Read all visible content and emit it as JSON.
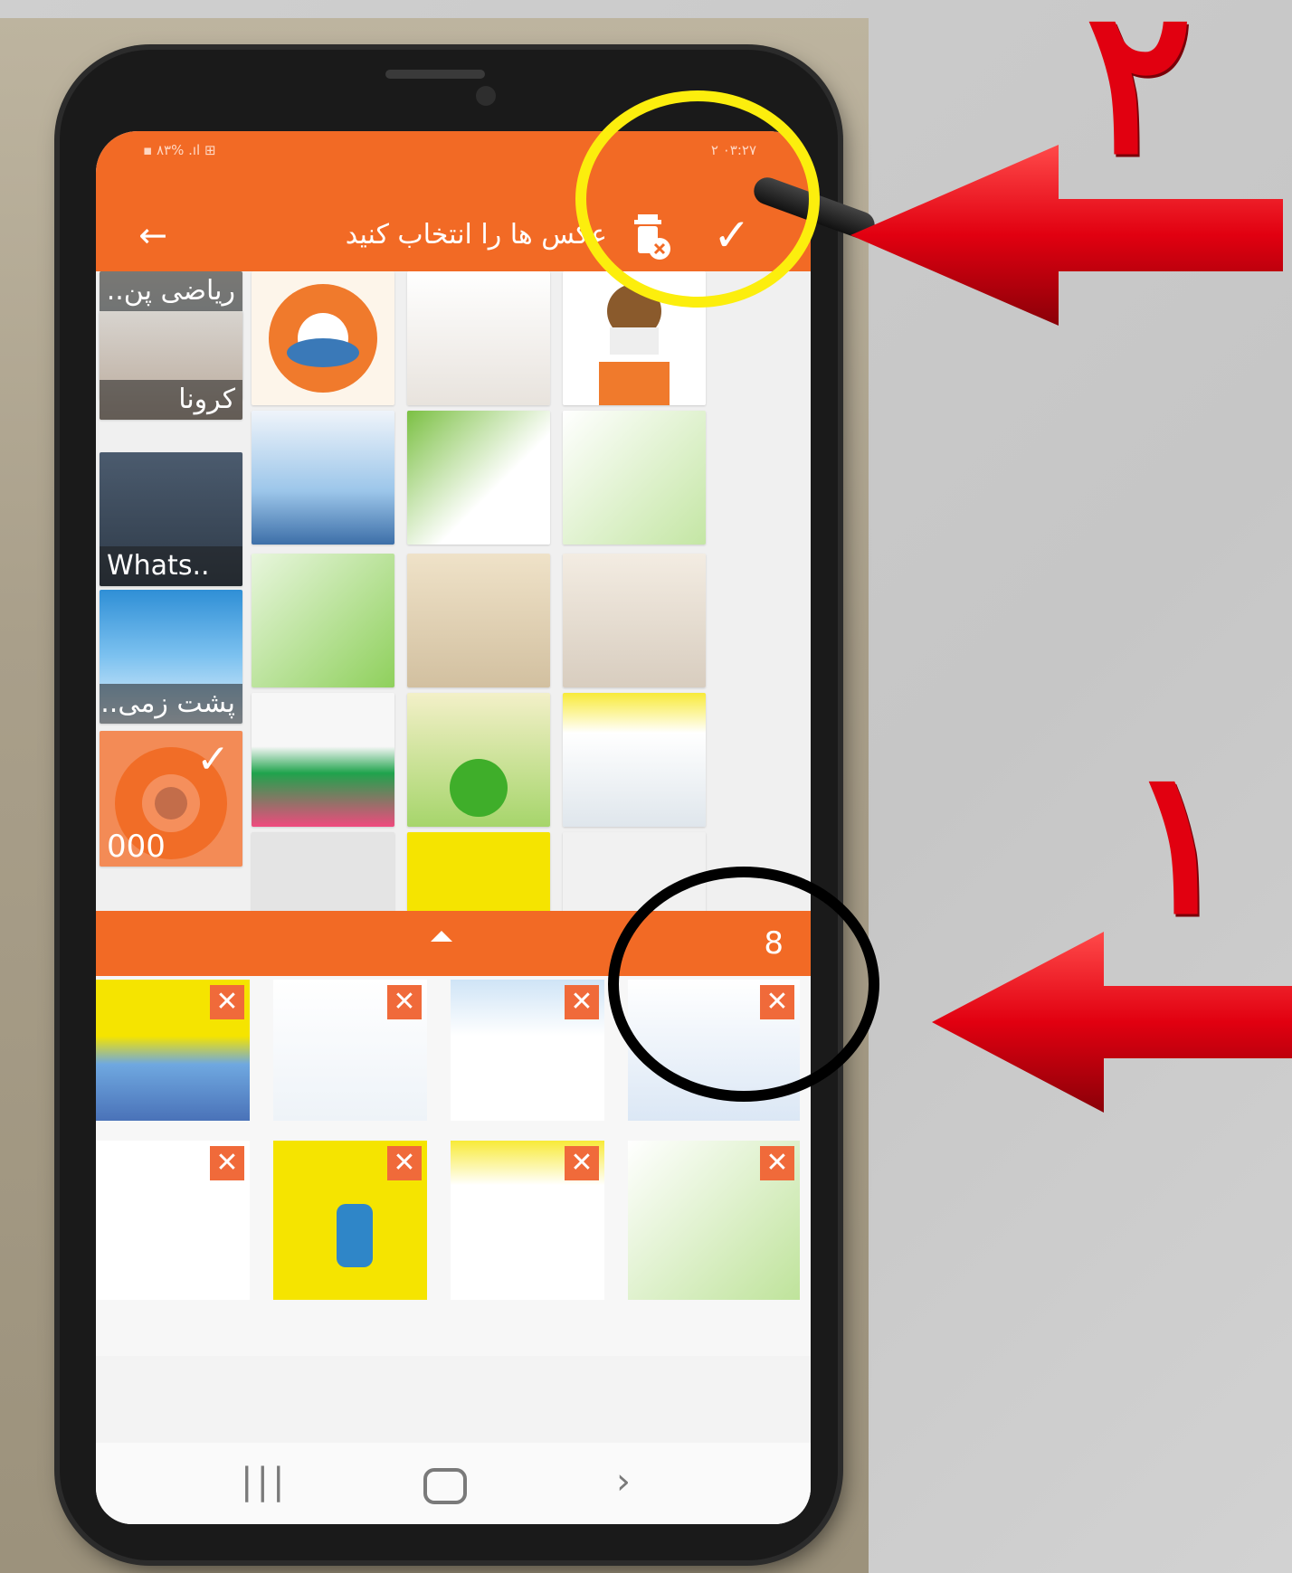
{
  "status_bar": {
    "left": "▪ ٨٣% ‎.ıl ⊞",
    "right": "۲ ۰۳:۲۷"
  },
  "app_bar": {
    "title": "عکس ها را انتخاب کنید",
    "back_icon": "arrow-left-icon",
    "trash_icon": "trash-icon",
    "confirm_icon": "checkmark-icon",
    "color": "#f26a25"
  },
  "albums": [
    {
      "label": "ریاضی پن.."
    },
    {
      "label": "کرونا"
    },
    {
      "label": "Whats.."
    },
    {
      "label": "پشت زمی.."
    },
    {
      "label": "000"
    }
  ],
  "selection_bar": {
    "count": "8",
    "expand_icon": "triangle-up-icon"
  },
  "selected_remove_icon": "close-x-icon",
  "nav_bar": {
    "recent_icon": "recent-apps-icon",
    "home_icon": "home-icon",
    "back_icon": "chevron-right-icon"
  },
  "annotations": {
    "step_two": "۲",
    "step_one": "۱",
    "arrow_color": "#e10010",
    "highlight_yellow": "#fcee0d",
    "highlight_black": "#000000"
  }
}
